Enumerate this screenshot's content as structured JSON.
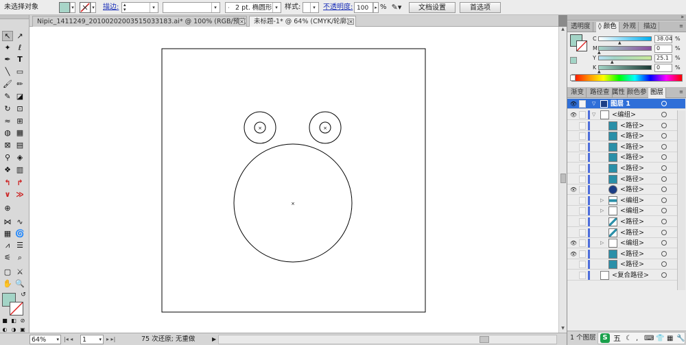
{
  "control_bar": {
    "selection_status": "未选择对象",
    "stroke_link": "描边:",
    "stroke_weight_value": "",
    "brush_label": "2 pt. 椭圆形",
    "style_label": "样式:",
    "opacity_link": "不透明度:",
    "opacity_value": "100",
    "percent": "%",
    "doc_setup_button": "文档设置",
    "preferences_button": "首选项"
  },
  "tabs": [
    {
      "label": "Nipic_1411249_20100202003515033183.ai* @ 100% (RGB/预览)",
      "close": "×"
    },
    {
      "label": "未标题-1* @ 64% (CMYK/轮廓)",
      "close": "×"
    }
  ],
  "status_bar": {
    "zoom": "64%",
    "artboard": "1",
    "message": "75 次还原; 无重做"
  },
  "color_panel": {
    "tabs": [
      "透明度",
      "颜色",
      "外观",
      "描边"
    ],
    "active_tab": "颜色",
    "channels": [
      {
        "name": "C",
        "value": "38.04",
        "unit": "%",
        "level": 38.04
      },
      {
        "name": "M",
        "value": "0",
        "unit": "%",
        "level": 0
      },
      {
        "name": "Y",
        "value": "25.1",
        "unit": "%",
        "level": 25.1
      },
      {
        "name": "K",
        "value": "0",
        "unit": "%",
        "level": 0
      }
    ],
    "fill_color": "#a3d4c6"
  },
  "layers_panel": {
    "tabs": [
      "渐变",
      "路径查",
      "属性",
      "颜色参",
      "图层"
    ],
    "active_tab": "图层",
    "layer_name": "图层 1",
    "rows": [
      {
        "label": "<编组>",
        "eye": true,
        "twist": "▽",
        "indent": 1,
        "thumb": "group"
      },
      {
        "label": "<路径>",
        "eye": false,
        "twist": "",
        "indent": 2,
        "thumb": "teal"
      },
      {
        "label": "<路径>",
        "eye": false,
        "twist": "",
        "indent": 2,
        "thumb": "teal"
      },
      {
        "label": "<路径>",
        "eye": false,
        "twist": "",
        "indent": 2,
        "thumb": "teal"
      },
      {
        "label": "<路径>",
        "eye": false,
        "twist": "",
        "indent": 2,
        "thumb": "teal"
      },
      {
        "label": "<路径>",
        "eye": false,
        "twist": "",
        "indent": 2,
        "thumb": "teal"
      },
      {
        "label": "<路径>",
        "eye": false,
        "twist": "",
        "indent": 2,
        "thumb": "teal"
      },
      {
        "label": "<路径>",
        "eye": true,
        "twist": "",
        "indent": 2,
        "thumb": "navy"
      },
      {
        "label": "<编组>",
        "eye": false,
        "twist": "▷",
        "indent": 2,
        "thumb": "group2"
      },
      {
        "label": "<编组>",
        "eye": false,
        "twist": "▷",
        "indent": 2,
        "thumb": "white"
      },
      {
        "label": "<路径>",
        "eye": false,
        "twist": "",
        "indent": 2,
        "thumb": "slash"
      },
      {
        "label": "<路径>",
        "eye": false,
        "twist": "",
        "indent": 2,
        "thumb": "slash"
      },
      {
        "label": "<编组>",
        "eye": true,
        "twist": "▷",
        "indent": 2,
        "thumb": "white"
      },
      {
        "label": "<路径>",
        "eye": true,
        "twist": "",
        "indent": 2,
        "thumb": "teal"
      },
      {
        "label": "<路径>",
        "eye": false,
        "twist": "",
        "indent": 2,
        "thumb": "teal"
      },
      {
        "label": "<复合路径>",
        "eye": false,
        "twist": "",
        "indent": 1,
        "thumb": "white"
      }
    ],
    "footer_count": "1 个图层"
  },
  "ime_bar": {
    "logo": "S",
    "mode": "五",
    "icons": [
      "moon-icon",
      "comma-icon",
      "keyboard-icon",
      "shirt-icon",
      "grid-icon",
      "wrench-icon"
    ]
  },
  "colors": {
    "accent_blue": "#2f6fd8",
    "layer_color": "#4d6ddb",
    "teal_fill": "#2a8fa8"
  }
}
